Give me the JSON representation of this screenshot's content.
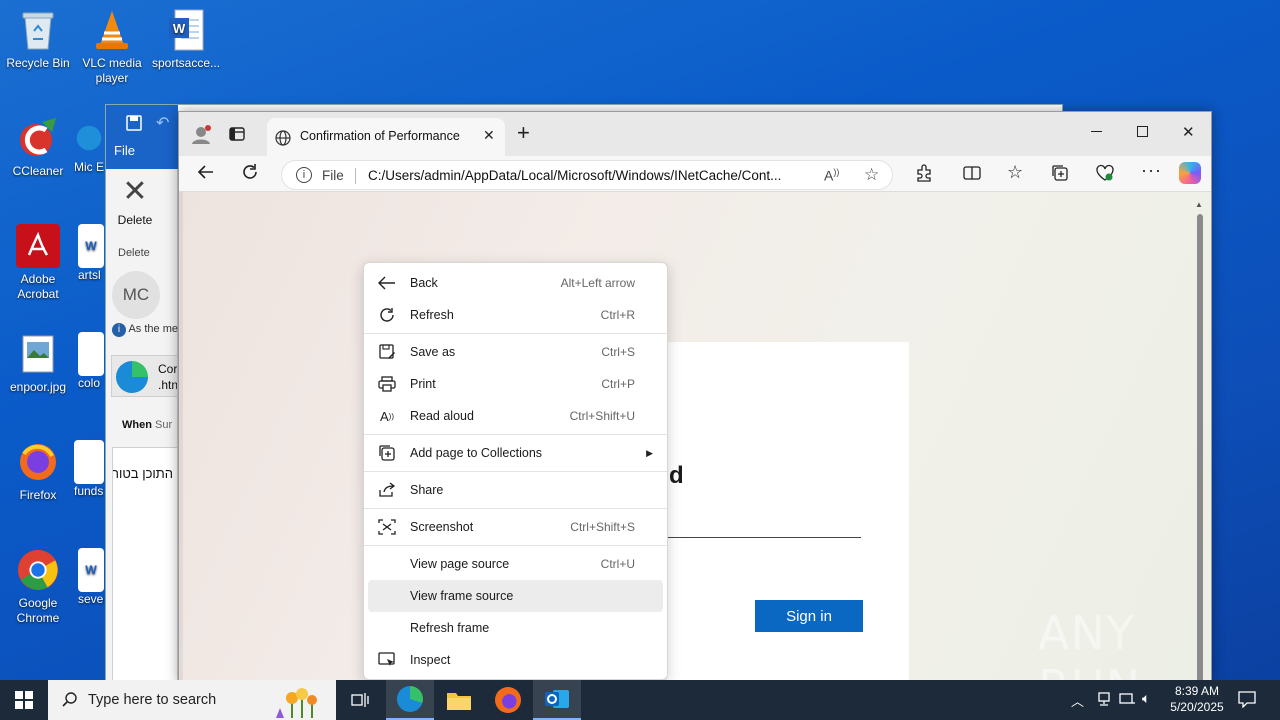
{
  "desktop": {
    "icons": [
      {
        "label": "Recycle Bin"
      },
      {
        "label": "VLC media player"
      },
      {
        "label": "sportsacce..."
      },
      {
        "label": "CCleaner"
      },
      {
        "label": "Mic E"
      },
      {
        "label": "Adobe Acrobat"
      },
      {
        "label": "artsl"
      },
      {
        "label": "enpoor.jpg"
      },
      {
        "label": "colo"
      },
      {
        "label": "Firefox"
      },
      {
        "label": "funds"
      },
      {
        "label": "Google Chrome"
      },
      {
        "label": "sever"
      }
    ]
  },
  "outlook": {
    "file_tab": "File",
    "delete_label": "Delete",
    "delete_group": "Delete",
    "avatar_initials": "MC",
    "info_text": "As the me",
    "attachment_name": "Cor",
    "attachment_ext": ".htn",
    "when_label": "When",
    "when_value": "Sur",
    "body_text": "התוכן בטוח"
  },
  "browser": {
    "tab_title": "Confirmation of Performance",
    "address_scheme": "File",
    "address_url": "C:/Users/admin/AppData/Local/Microsoft/Windows/INetCache/Cont...",
    "page": {
      "heading_fragment": "d",
      "signin_label": "Sign in"
    }
  },
  "context_menu": {
    "items": [
      {
        "icon": "back-arrow-icon",
        "label": "Back",
        "shortcut": "Alt+Left arrow"
      },
      {
        "icon": "refresh-icon",
        "label": "Refresh",
        "shortcut": "Ctrl+R"
      },
      {
        "icon": "save-as-icon",
        "label": "Save as",
        "shortcut": "Ctrl+S"
      },
      {
        "icon": "print-icon",
        "label": "Print",
        "shortcut": "Ctrl+P"
      },
      {
        "icon": "read-aloud-icon",
        "label": "Read aloud",
        "shortcut": "Ctrl+Shift+U"
      },
      {
        "icon": "collections-icon",
        "label": "Add page to Collections",
        "shortcut": ""
      },
      {
        "icon": "share-icon",
        "label": "Share",
        "shortcut": ""
      },
      {
        "icon": "screenshot-icon",
        "label": "Screenshot",
        "shortcut": "Ctrl+Shift+S"
      },
      {
        "icon": "",
        "label": "View page source",
        "shortcut": "Ctrl+U"
      },
      {
        "icon": "",
        "label": "View frame source",
        "shortcut": ""
      },
      {
        "icon": "",
        "label": "Refresh frame",
        "shortcut": ""
      },
      {
        "icon": "inspect-icon",
        "label": "Inspect",
        "shortcut": ""
      }
    ],
    "highlighted": "View frame source"
  },
  "taskbar": {
    "search_placeholder": "Type here to search",
    "time": "8:39 AM",
    "date": "5/20/2025"
  },
  "watermark": "ANY RUN"
}
